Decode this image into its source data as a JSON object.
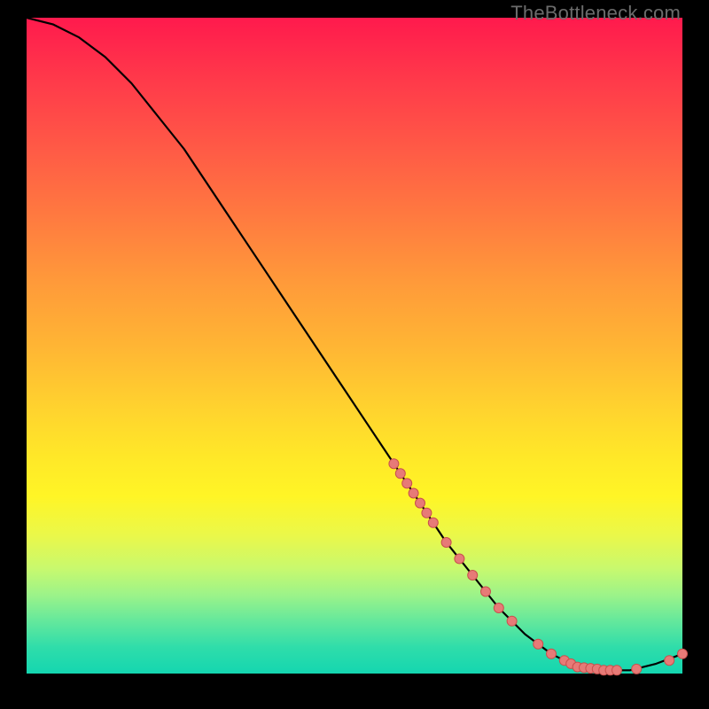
{
  "watermark": "TheBottleneck.com",
  "chart_data": {
    "type": "line",
    "title": "",
    "xlabel": "",
    "ylabel": "",
    "xlim": [
      0,
      100
    ],
    "ylim": [
      0,
      100
    ],
    "series": [
      {
        "name": "curve",
        "x": [
          0,
          4,
          8,
          12,
          16,
          20,
          24,
          28,
          32,
          36,
          40,
          44,
          48,
          52,
          56,
          60,
          64,
          68,
          72,
          76,
          80,
          84,
          88,
          92,
          96,
          100
        ],
        "y": [
          100,
          99,
          97,
          94,
          90,
          85,
          80,
          74,
          68,
          62,
          56,
          50,
          44,
          38,
          32,
          26,
          20,
          15,
          10,
          6,
          3,
          1,
          0.5,
          0.5,
          1.5,
          3
        ]
      }
    ],
    "markers": [
      {
        "x": 56,
        "y": 32
      },
      {
        "x": 57,
        "y": 30.5
      },
      {
        "x": 58,
        "y": 29
      },
      {
        "x": 59,
        "y": 27.5
      },
      {
        "x": 60,
        "y": 26
      },
      {
        "x": 61,
        "y": 24.5
      },
      {
        "x": 62,
        "y": 23
      },
      {
        "x": 64,
        "y": 20
      },
      {
        "x": 66,
        "y": 17.5
      },
      {
        "x": 68,
        "y": 15
      },
      {
        "x": 70,
        "y": 12.5
      },
      {
        "x": 72,
        "y": 10
      },
      {
        "x": 74,
        "y": 8
      },
      {
        "x": 78,
        "y": 4.5
      },
      {
        "x": 80,
        "y": 3
      },
      {
        "x": 82,
        "y": 2
      },
      {
        "x": 83,
        "y": 1.5
      },
      {
        "x": 84,
        "y": 1
      },
      {
        "x": 85,
        "y": 0.9
      },
      {
        "x": 86,
        "y": 0.8
      },
      {
        "x": 87,
        "y": 0.7
      },
      {
        "x": 88,
        "y": 0.5
      },
      {
        "x": 89,
        "y": 0.5
      },
      {
        "x": 90,
        "y": 0.5
      },
      {
        "x": 93,
        "y": 0.7
      },
      {
        "x": 98,
        "y": 2
      },
      {
        "x": 100,
        "y": 3
      }
    ],
    "colors": {
      "line": "#000000",
      "marker_fill": "#e77a77",
      "marker_stroke": "#c9504d"
    }
  }
}
